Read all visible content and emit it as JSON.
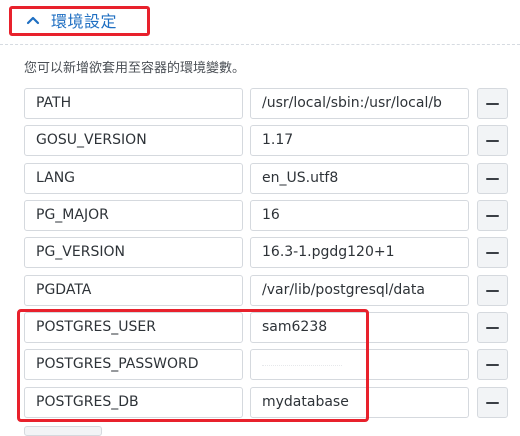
{
  "section": {
    "title": "環境設定",
    "description": "您可以新增欲套用至容器的環境變數。"
  },
  "env_vars": [
    {
      "key": "PATH",
      "value": "/usr/local/sbin:/usr/local/b"
    },
    {
      "key": "GOSU_VERSION",
      "value": "1.17"
    },
    {
      "key": "LANG",
      "value": "en_US.utf8"
    },
    {
      "key": "PG_MAJOR",
      "value": "16"
    },
    {
      "key": "PG_VERSION",
      "value": "16.3-1.pgdg120+1"
    },
    {
      "key": "PGDATA",
      "value": "/var/lib/postgresql/data"
    },
    {
      "key": "POSTGRES_USER",
      "value": "sam6238"
    },
    {
      "key": "POSTGRES_PASSWORD",
      "value": ""
    },
    {
      "key": "POSTGRES_DB",
      "value": "mydatabase"
    }
  ],
  "icons": {
    "collapse": "chevron-up-icon",
    "remove": "minus-icon"
  },
  "colors": {
    "title": "#1f6fc2",
    "annotation": "#e8212c"
  }
}
